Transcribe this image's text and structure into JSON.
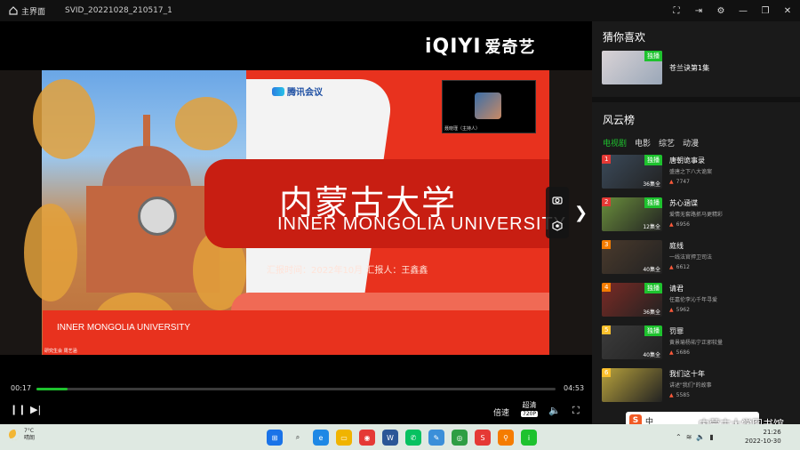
{
  "window": {
    "home_label": "主界面",
    "file_title": "SVID_20221028_210517_1"
  },
  "player": {
    "watermark_brand": "iQIYI",
    "watermark_cn": "爱奇艺",
    "time_current": "00:17",
    "time_total": "04:53",
    "progress": 0.06,
    "speed_label": "倍速",
    "quality_label": "超清",
    "quality_badge": "720P"
  },
  "slide": {
    "meeting_logo": "腾讯会议",
    "title_cn": "内蒙古大学",
    "title_en": "INNER  MONGOLIA  UNIVERSITY",
    "meta": "汇报时间：2022年10月   汇报人：王鑫鑫",
    "footer_en": "INNER MONGOLIA UNIVERSITY",
    "footer_small": "研究生会 周艺涵",
    "host_name": "聂晓瑾（主持人）"
  },
  "sidebar": {
    "guess_title": "猜你喜欢",
    "guess_item": {
      "name": "苍兰诀第1集",
      "tag": "独播"
    },
    "rank_title": "风云榜",
    "tabs": [
      "电视剧",
      "电影",
      "综艺",
      "动漫"
    ],
    "items": [
      {
        "rank": "1",
        "title": "唐朝诡事录",
        "desc": "盛唐之下八大诡案",
        "heat": "7747",
        "tag": "独播",
        "ep": "36集全",
        "color": "#3b4a5a"
      },
      {
        "rank": "2",
        "title": "苏心涵谍",
        "desc": "爱情无套路抓马更精彩",
        "heat": "6956",
        "tag": "独播",
        "ep": "12集全",
        "color": "#6a8e3c"
      },
      {
        "rank": "3",
        "title": "庭线",
        "desc": "一线法官捍卫司法",
        "heat": "6612",
        "tag": "",
        "ep": "40集全",
        "color": "#4a3a2c"
      },
      {
        "rank": "4",
        "title": "请君",
        "desc": "任嘉伦李沁千年寻爱",
        "heat": "5962",
        "tag": "独播",
        "ep": "36集全",
        "color": "#7a2a24"
      },
      {
        "rank": "5",
        "title": "罚罪",
        "desc": "黄景瑜杨祐宁正邪较量",
        "heat": "5686",
        "tag": "独播",
        "ep": "40集全",
        "color": "#3c3c3c"
      },
      {
        "rank": "6",
        "title": "我们这十年",
        "desc": "讲述\"我们\"的故事",
        "heat": "5585",
        "tag": "",
        "ep": "",
        "color": "#b8a23c"
      }
    ]
  },
  "taskbar": {
    "temp": "7°C",
    "weather": "晴朗",
    "time": "21:26",
    "date": "2022-10-30",
    "ime_label": "中",
    "library_watermark": "内蒙古大学图书馆"
  }
}
